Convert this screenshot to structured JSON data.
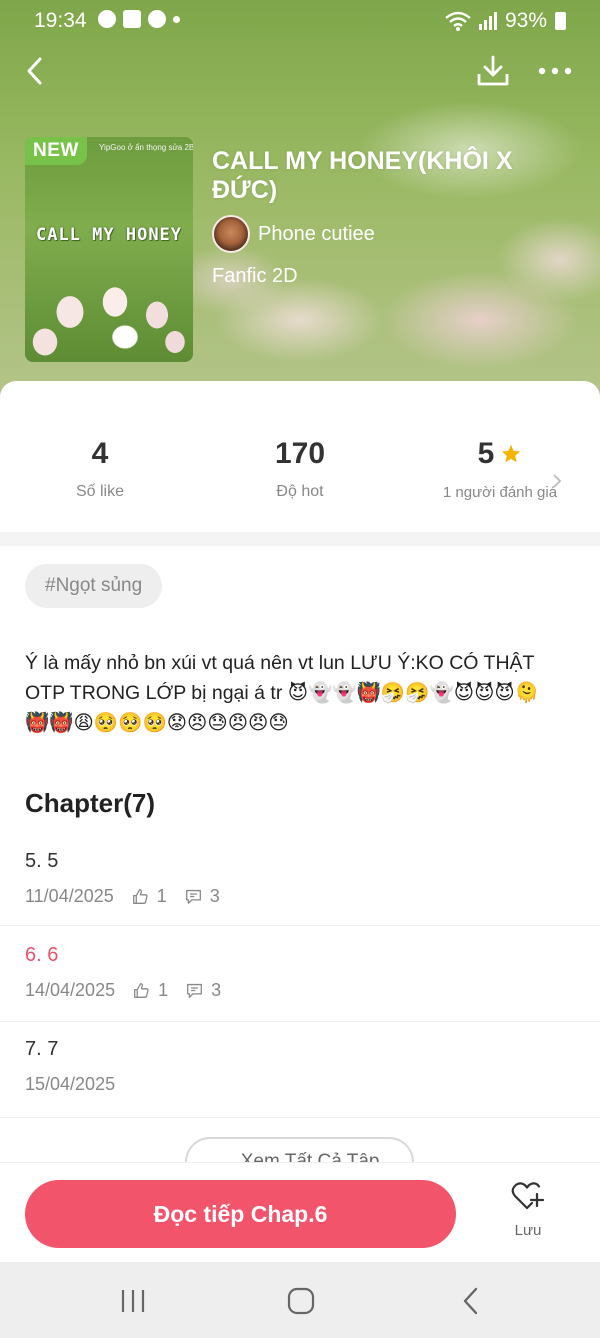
{
  "status_bar": {
    "time": "19:34",
    "battery": "93%"
  },
  "story": {
    "badge": "NEW",
    "cover_small_text": "YipGoo ở ẩn thọng sửa 2B",
    "cover_title": "CALL MY HONEY",
    "title": "CALL MY HONEY(KHÔI X ĐỨC)",
    "author": "Phone cutiee",
    "genre": "Fanfic 2D"
  },
  "stats": {
    "likes": {
      "value": "4",
      "label": "Số like"
    },
    "hot": {
      "value": "170",
      "label": "Độ hot"
    },
    "rating": {
      "value": "5",
      "label": "1 người đánh giá"
    }
  },
  "tag": "#Ngọt sủng",
  "description": "Ý là mấy nhỏ bn xúi vt quá nên vt lun LƯU Ý:KO CÓ THẬT OTP TRONG LỚP bị ngại á tr 😈👻👻👹🤧🤧👻😈😈😈🫠👹👹😩🥺🥺🥺😟😠😓😠😠😓",
  "chapters_heading": "Chapter(7)",
  "chapters": [
    {
      "title": "5. 5",
      "date": "11/04/2025",
      "likes": "1",
      "comments": "3"
    },
    {
      "title": "6. 6",
      "date": "14/04/2025",
      "likes": "1",
      "comments": "3"
    },
    {
      "title": "7. 7",
      "date": "15/04/2025"
    }
  ],
  "view_all": "Xem Tất Cả Tập",
  "actions": {
    "read": "Đọc tiếp Chap.6",
    "save": "Lưu"
  },
  "colors": {
    "accent": "#f2546c",
    "badge_green": "#79c24a",
    "star": "#f5b400"
  }
}
